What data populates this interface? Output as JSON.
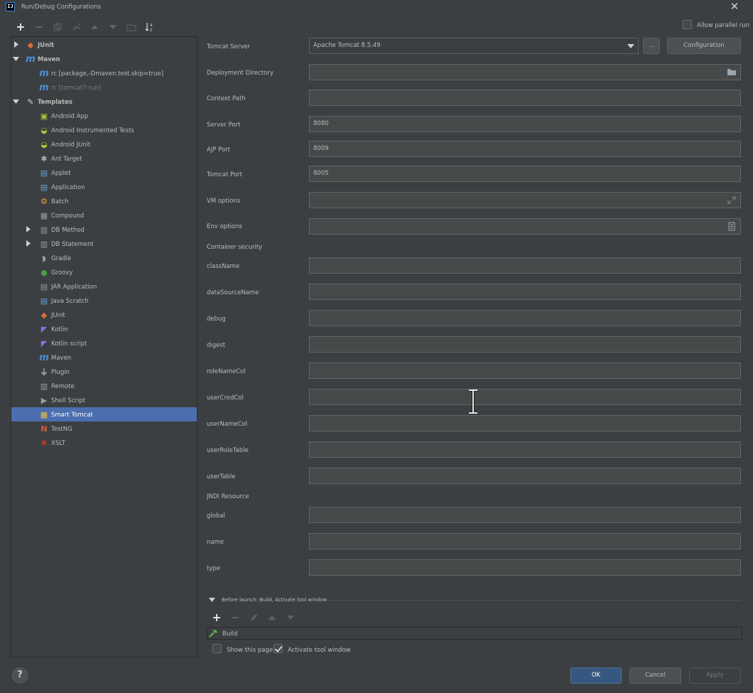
{
  "window": {
    "title": "Run/Debug Configurations",
    "app_icon_text": "IJ"
  },
  "allow_parallel_run": {
    "label": "Allow parallel run",
    "checked": false
  },
  "tree": {
    "items": [
      {
        "label": "JUnit",
        "bold": true,
        "icon": "junit-icon",
        "expanded": false
      },
      {
        "label": "Maven",
        "bold": true,
        "icon": "maven-icon",
        "expanded": true
      },
      {
        "label": "rc [package,-Dmaven.test.skip=true]",
        "icon": "maven-icon"
      },
      {
        "label": "rc [tomcat7:run]",
        "icon": "maven-icon",
        "dim": true
      },
      {
        "label": "Templates",
        "bold": true,
        "icon": "wrench-icon",
        "expanded": true
      },
      {
        "label": "Android App",
        "icon": "android-app-icon"
      },
      {
        "label": "Android Instrumented Tests",
        "icon": "android-icon"
      },
      {
        "label": "Android JUnit",
        "icon": "android-icon"
      },
      {
        "label": "Ant Target",
        "icon": "ant-icon"
      },
      {
        "label": "Applet",
        "icon": "applet-icon"
      },
      {
        "label": "Application",
        "icon": "application-icon"
      },
      {
        "label": "Batch",
        "icon": "batch-icon"
      },
      {
        "label": "Compound",
        "icon": "compound-icon"
      },
      {
        "label": "DB Method",
        "icon": "db-method-icon",
        "expanded": false
      },
      {
        "label": "DB Statement",
        "icon": "db-statement-icon",
        "expanded": false
      },
      {
        "label": "Gradle",
        "icon": "gradle-icon"
      },
      {
        "label": "Groovy",
        "icon": "groovy-icon"
      },
      {
        "label": "JAR Application",
        "icon": "jar-icon"
      },
      {
        "label": "Java Scratch",
        "icon": "java-scratch-icon"
      },
      {
        "label": "JUnit",
        "icon": "junit-icon"
      },
      {
        "label": "Kotlin",
        "icon": "kotlin-icon"
      },
      {
        "label": "Kotlin script",
        "icon": "kotlin-icon"
      },
      {
        "label": "Maven",
        "icon": "maven-icon"
      },
      {
        "label": "Plugin",
        "icon": "plugin-icon"
      },
      {
        "label": "Remote",
        "icon": "remote-icon"
      },
      {
        "label": "Shell Script",
        "icon": "shell-icon"
      },
      {
        "label": "Smart Tomcat",
        "icon": "smart-tomcat-icon",
        "selected": true
      },
      {
        "label": "TestNG",
        "icon": "testng-icon"
      },
      {
        "label": "XSLT",
        "icon": "xslt-icon"
      }
    ]
  },
  "form": {
    "tomcat_server": {
      "label": "Tomcat Server",
      "value": "Apache Tomcat 8.5.49",
      "browse_label": "...",
      "config_label": "Configuration"
    },
    "deployment_directory": {
      "label": "Deployment Directory",
      "value": ""
    },
    "context_path": {
      "label": "Context Path",
      "value": ""
    },
    "server_port": {
      "label": "Server Port",
      "value": "8080"
    },
    "ajp_port": {
      "label": "AJP Port",
      "value": "8009"
    },
    "tomcat_port": {
      "label": "Tomcat Port",
      "value": "8005"
    },
    "vm_options": {
      "label": "VM options",
      "value": ""
    },
    "env_options": {
      "label": "Env options",
      "value": ""
    },
    "container_security_header": "Container security",
    "class_name": {
      "label": "className",
      "value": ""
    },
    "data_source_name": {
      "label": "dataSourceName",
      "value": ""
    },
    "debug": {
      "label": "debug",
      "value": ""
    },
    "digest": {
      "label": "digest",
      "value": ""
    },
    "role_name_col": {
      "label": "roleNameCol",
      "value": ""
    },
    "user_cred_col": {
      "label": "userCredCol",
      "value": ""
    },
    "user_name_col": {
      "label": "userNameCol",
      "value": ""
    },
    "user_role_table": {
      "label": "userRoleTable",
      "value": ""
    },
    "user_table": {
      "label": "userTable",
      "value": ""
    },
    "jndi_header": "JNDI Resource",
    "global": {
      "label": "global",
      "value": ""
    },
    "name": {
      "label": "name",
      "value": ""
    },
    "type": {
      "label": "type",
      "value": ""
    }
  },
  "before_launch": {
    "header": "Before launch: Build, Activate tool window",
    "tasks": [
      {
        "label": "Build",
        "icon": "hammer-icon"
      }
    ],
    "show_this_page": {
      "label": "Show this page",
      "checked": false
    },
    "activate_tool_window": {
      "label": "Activate tool window",
      "checked": true
    }
  },
  "footer": {
    "ok": "OK",
    "cancel": "Cancel",
    "apply": "Apply",
    "help": "?"
  },
  "colors": {
    "selection": "#4b6eaf",
    "background": "#3c3f41",
    "input_bg": "#45494a",
    "primary_button": "#365880"
  }
}
